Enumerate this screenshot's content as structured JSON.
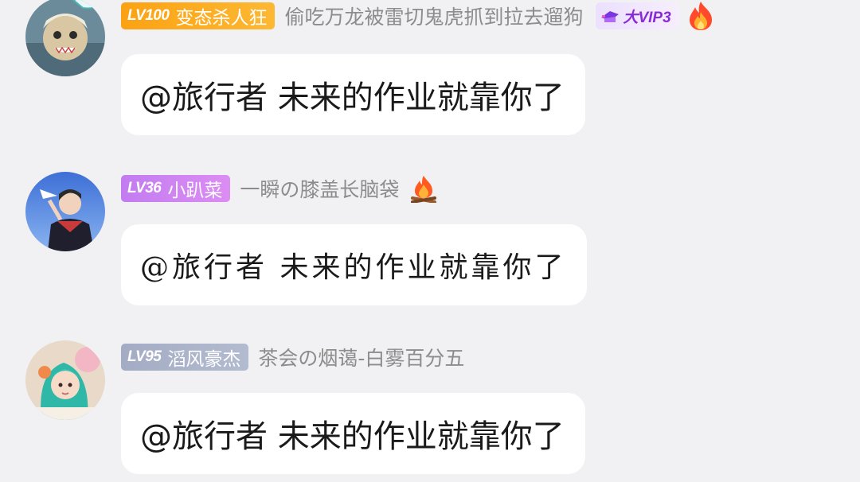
{
  "messages": [
    {
      "level": "LV100",
      "username": "变态杀人狂",
      "title": "偷吃万龙被雷切鬼虎抓到拉去遛狗",
      "vip": "大VIP3",
      "fire_icon": "fire-icon",
      "text": "@旅行者 未来的作业就靠你了"
    },
    {
      "level": "LV36",
      "username": "小趴菜",
      "title": "一瞬の膝盖长脑袋",
      "fire_icon": "campfire-icon",
      "text": "@旅行者 未来的作业就靠你了"
    },
    {
      "level": "LV95",
      "username": "滔风豪杰",
      "title": "茶会の烟蔼-白雾百分五",
      "text": "@旅行者 未来的作业就靠你了"
    }
  ],
  "colors": {
    "background": "#f1f1f3",
    "bubble": "#ffffff",
    "badge_orange": "#fba213",
    "badge_violet": "#c27cf0",
    "badge_slate": "#a3acc4",
    "title_gray": "#8c8c8c",
    "vip_purple": "#8a2ad6"
  }
}
